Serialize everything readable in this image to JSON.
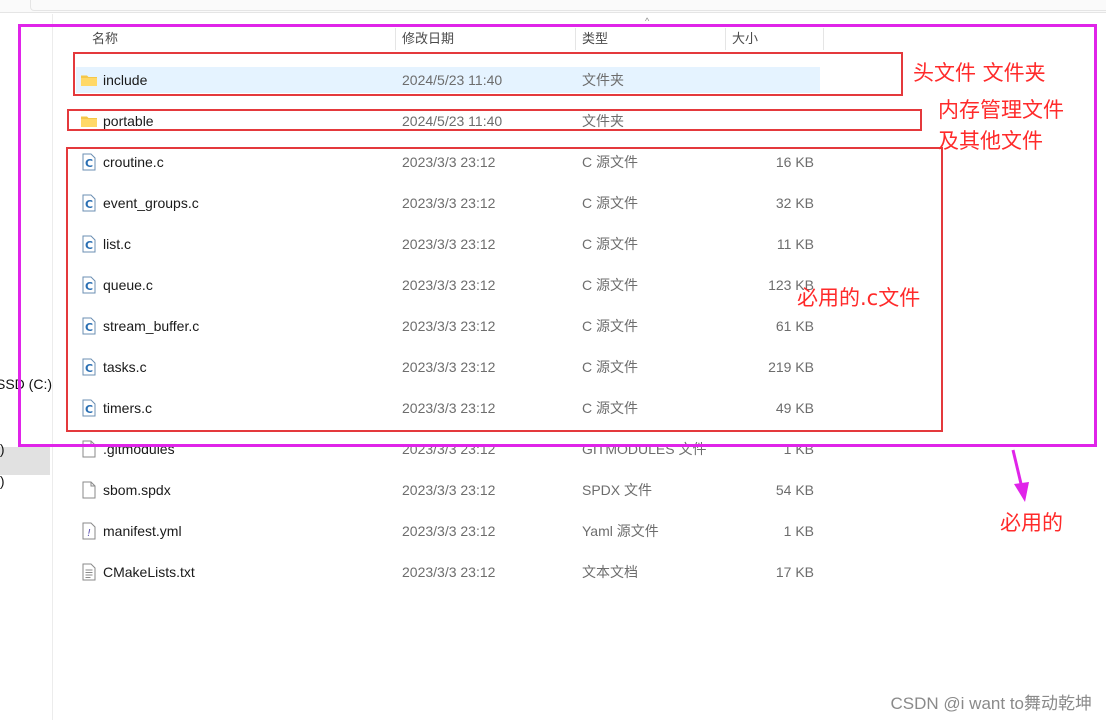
{
  "columns": {
    "name": "名称",
    "modified": "修改日期",
    "type": "类型",
    "size": "大小"
  },
  "nav": [
    {
      "label": "SSD (C:)"
    },
    {
      "label": ":)"
    },
    {
      "label": ":)"
    }
  ],
  "files": [
    {
      "name": "include",
      "date": "2024/5/23 11:40",
      "type": "文件夹",
      "size": "",
      "icon": "folder-icon"
    },
    {
      "name": "portable",
      "date": "2024/5/23 11:40",
      "type": "文件夹",
      "size": "",
      "icon": "folder-icon"
    },
    {
      "name": "croutine.c",
      "date": "2023/3/3 23:12",
      "type": "C 源文件",
      "size": "16 KB",
      "icon": "c-source-file-icon"
    },
    {
      "name": "event_groups.c",
      "date": "2023/3/3 23:12",
      "type": "C 源文件",
      "size": "32 KB",
      "icon": "c-source-file-icon"
    },
    {
      "name": "list.c",
      "date": "2023/3/3 23:12",
      "type": "C 源文件",
      "size": "11 KB",
      "icon": "c-source-file-icon"
    },
    {
      "name": "queue.c",
      "date": "2023/3/3 23:12",
      "type": "C 源文件",
      "size": "123 KB",
      "icon": "c-source-file-icon"
    },
    {
      "name": "stream_buffer.c",
      "date": "2023/3/3 23:12",
      "type": "C 源文件",
      "size": "61 KB",
      "icon": "c-source-file-icon"
    },
    {
      "name": "tasks.c",
      "date": "2023/3/3 23:12",
      "type": "C 源文件",
      "size": "219 KB",
      "icon": "c-source-file-icon"
    },
    {
      "name": "timers.c",
      "date": "2023/3/3 23:12",
      "type": "C 源文件",
      "size": "49 KB",
      "icon": "c-source-file-icon"
    },
    {
      "name": ".gitmodules",
      "date": "2023/3/3 23:12",
      "type": "GITMODULES 文件",
      "size": "1 KB",
      "icon": "blank-file-icon"
    },
    {
      "name": "sbom.spdx",
      "date": "2023/3/3 23:12",
      "type": "SPDX 文件",
      "size": "54 KB",
      "icon": "blank-file-icon"
    },
    {
      "name": "manifest.yml",
      "date": "2023/3/3 23:12",
      "type": "Yaml 源文件",
      "size": "1 KB",
      "icon": "yaml-file-icon"
    },
    {
      "name": "CMakeLists.txt",
      "date": "2023/3/3 23:12",
      "type": "文本文档",
      "size": "17 KB",
      "icon": "text-file-icon"
    }
  ],
  "annotations": {
    "header_files": "头文件 文件夹",
    "memory_line1": "内存管理文件",
    "memory_line2": "及其他文件",
    "required_c": "必用的.c文件",
    "required": "必用的"
  },
  "watermark": "CSDN @i want to舞动乾坤",
  "colors": {
    "annotation_box": "#e4393c",
    "outer_box": "#e024e9",
    "annotation_text": "#ff2a2a",
    "selected_row": "#e5f3ff"
  }
}
